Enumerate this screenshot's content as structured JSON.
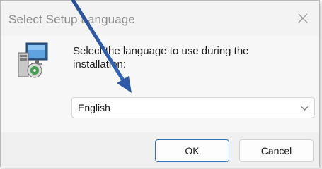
{
  "dialog": {
    "title": "Select Setup Language",
    "prompt": "Select the language to use during the installation:",
    "language_select": {
      "selected": "English"
    },
    "buttons": {
      "ok": "OK",
      "cancel": "Cancel"
    }
  },
  "annotation": {
    "arrow_color": "#2f5aa8"
  }
}
